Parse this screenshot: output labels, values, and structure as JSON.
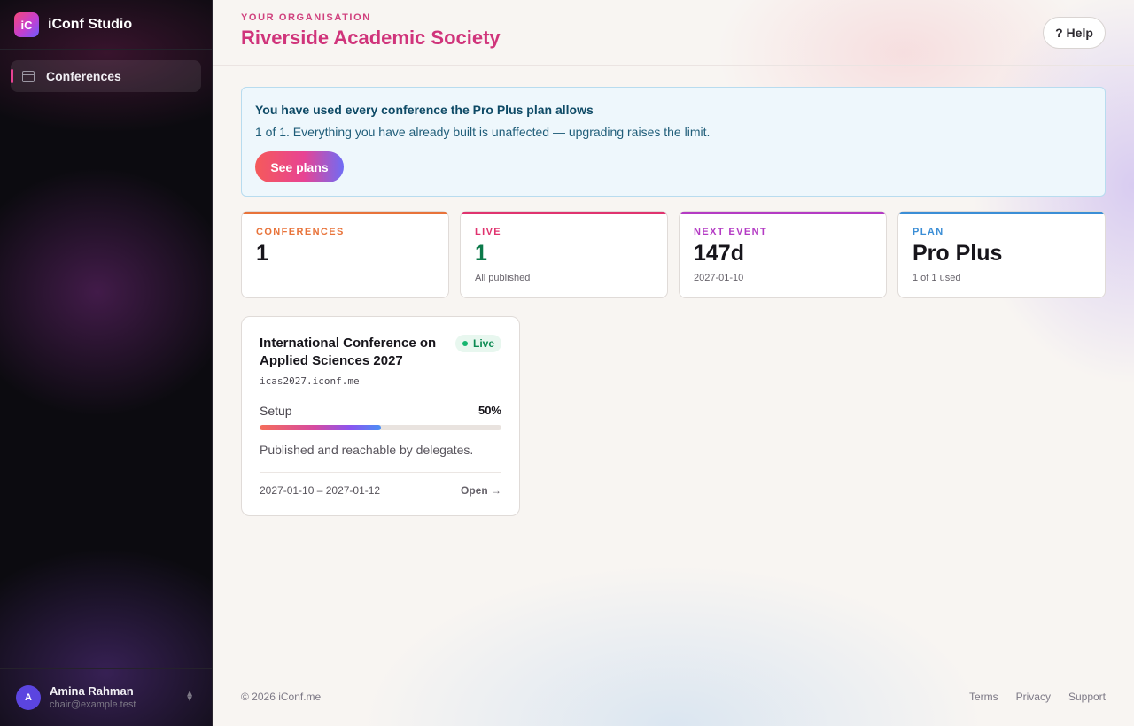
{
  "app": {
    "logo_text": "iC",
    "name": "iConf Studio"
  },
  "sidebar": {
    "items": [
      {
        "label": "Conferences",
        "icon": "calendar-icon",
        "active": true
      }
    ]
  },
  "user": {
    "initial": "A",
    "name": "Amina Rahman",
    "email": "chair@example.test"
  },
  "header": {
    "org_label": "YOUR ORGANISATION",
    "org_name": "Riverside Academic Society",
    "help_label": "? Help"
  },
  "alert": {
    "title": "You have used every conference the Pro Plus plan allows",
    "text": "1 of 1. Everything you have already built is unaffected — upgrading raises the limit.",
    "button": "See plans"
  },
  "stats": [
    {
      "label": "CONFERENCES",
      "value": "1",
      "sub": "",
      "accent": "#e8733a",
      "value_color": "#17151b"
    },
    {
      "label": "LIVE",
      "value": "1",
      "sub": "All published",
      "accent": "#e0336f",
      "value_color": "#0c7a4a"
    },
    {
      "label": "NEXT EVENT",
      "value": "147d",
      "sub": "2027-01-10",
      "accent": "#b43bc4",
      "value_color": "#17151b"
    },
    {
      "label": "PLAN",
      "value": "Pro Plus",
      "sub": "1 of 1 used",
      "accent": "#3b8ed6",
      "value_color": "#17151b"
    }
  ],
  "conference": {
    "title": "International Conference on Applied Sciences 2027",
    "status": "Live",
    "url": "icas2027.iconf.me",
    "setup_label": "Setup",
    "setup_percent_text": "50%",
    "setup_progress": 0.5,
    "description": "Published and reachable by delegates.",
    "dates": "2027-01-10 – 2027-01-12",
    "open_label": "Open →"
  },
  "footer": {
    "copyright": "© 2026 iConf.me",
    "links": [
      "Terms",
      "Privacy",
      "Support"
    ]
  }
}
